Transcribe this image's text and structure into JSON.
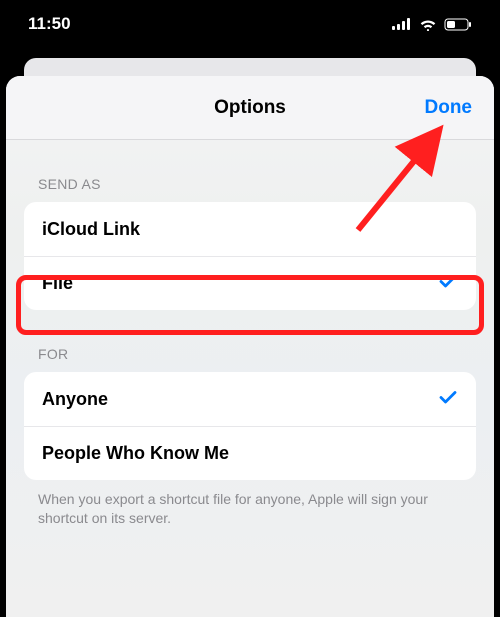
{
  "status_bar": {
    "time": "11:50",
    "signal_name": "cellular-signal-icon",
    "wifi_name": "wifi-icon",
    "battery_name": "battery-icon"
  },
  "header": {
    "title": "Options",
    "done_label": "Done"
  },
  "sections": {
    "send_as": {
      "header": "SEND AS",
      "items": [
        {
          "label": "iCloud Link",
          "selected": false
        },
        {
          "label": "File",
          "selected": true
        }
      ]
    },
    "for": {
      "header": "FOR",
      "items": [
        {
          "label": "Anyone",
          "selected": true
        },
        {
          "label": "People Who Know Me",
          "selected": false
        }
      ],
      "footer": "When you export a shortcut file for anyone, Apple will sign your shortcut on its server."
    }
  },
  "colors": {
    "accent": "#007aff",
    "highlight": "#ff1f1f"
  }
}
